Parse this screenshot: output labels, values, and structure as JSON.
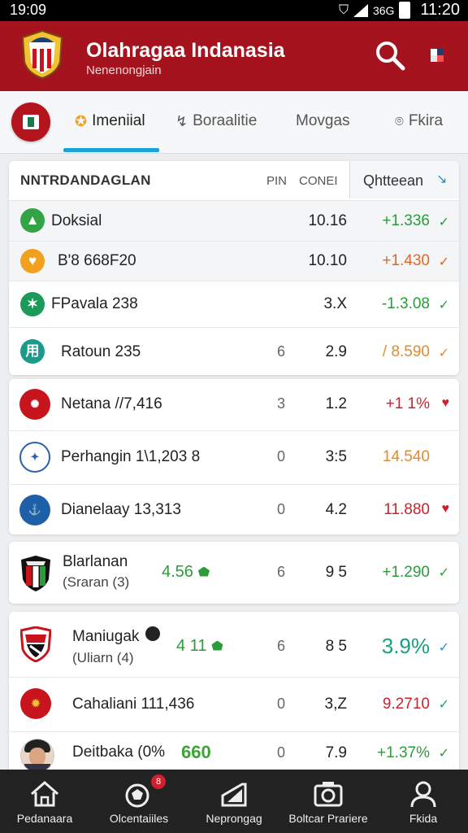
{
  "status": {
    "left_time": "19:09",
    "network": "36G",
    "right_time": "11:20"
  },
  "app": {
    "title": "Olahragaa Indanasia",
    "subtitle": "Nenenongjain"
  },
  "tabs": [
    {
      "label": "Imeniial",
      "icon": "trophy-icon",
      "active": true
    },
    {
      "label": "Boraalitie",
      "icon": "whistle-icon",
      "active": false
    },
    {
      "label": "Movgas",
      "icon": "none",
      "active": false
    },
    {
      "label": "Fkira",
      "icon": "location-icon",
      "active": false
    }
  ],
  "table": {
    "title": "NNTRDANDAGLAN",
    "col_pin": "PIN",
    "col_conv": "CONEI",
    "filter_label": "Qhtteean"
  },
  "group1": [
    {
      "name": "Doksial",
      "col1": "",
      "col2": "10.16",
      "change": "+1.336",
      "change_color": "#2a9d3a",
      "icon_color": "#33a346",
      "icon_glyph": "▲",
      "mark": "✓",
      "mark_color": "#2a9d3a"
    },
    {
      "name": "B'8 668F20",
      "col1": "",
      "col2": "10.10",
      "change": "+1.430",
      "change_color": "#e0662a",
      "icon_color": "#f2a01f",
      "icon_glyph": "♥",
      "mark": "✓",
      "mark_color": "#e0662a"
    },
    {
      "name": "FPavala 238",
      "col1": "",
      "col2": "3.X",
      "change": "-1.3.08",
      "change_color": "#2a9d3a",
      "icon_color": "#1b9a5a",
      "icon_glyph": "✶",
      "mark": "✓",
      "mark_color": "#2a9d3a"
    },
    {
      "name": "Ratoun 235",
      "col1": "6",
      "col2": "2.9",
      "change": "/ 8.590",
      "change_color": "#e38a2f",
      "icon_color": "#1a9a8a",
      "icon_glyph": "用",
      "mark": "✓",
      "mark_color": "#e38a2f"
    }
  ],
  "group2": [
    {
      "name": "Netana //7,416",
      "col1": "3",
      "col2": "1.2",
      "change": "+1 1%",
      "change_color": "#d0202c",
      "icon_color": "#c8141c",
      "mark": "♥",
      "mark_color": "#d0202c"
    },
    {
      "name": "Perhangin 1\\1,203 8",
      "col1": "0",
      "col2": "3:5",
      "change": "14.540",
      "change_color": "#e38a2f",
      "icon_color": "#2a5fb0",
      "mark": "",
      "mark_color": "#d0202c"
    },
    {
      "name": "Dianelaay 13,313",
      "col1": "0",
      "col2": "4.2",
      "change": "11.880",
      "change_color": "#d0202c",
      "icon_color": "#1e5fa8",
      "mark": "♥",
      "mark_color": "#d0202c"
    }
  ],
  "group3": [
    {
      "name": "Blarlanan",
      "sub": "(Sraran (3)",
      "extra": "4.56",
      "col1": "6",
      "col2": "9 5",
      "change": "+1.290",
      "change_color": "#2a9d3a",
      "mark": "✓",
      "mark_color": "#2a9d3a"
    }
  ],
  "group4": [
    {
      "name": "Maniugak",
      "sub": "(Uliarn (4)",
      "extra": "4 11",
      "col1": "6",
      "col2": "8 5",
      "change": "3.9%",
      "change_color": "#1aa07f",
      "mark": "✓",
      "mark_color": "#1a9ad0"
    },
    {
      "name": "Cahaliani 111,436",
      "col1": "0",
      "col2": "3,Z",
      "change": "9.2710",
      "change_color": "#d0202c",
      "mark": "✓",
      "mark_color": "#1aa07f"
    },
    {
      "name": "Deitbaka (0%",
      "badge": "660",
      "col1": "0",
      "col2": "7.9",
      "change": "+1.37%",
      "change_color": "#2a9d3a",
      "mark": "✓",
      "mark_color": "#2a9d3a"
    }
  ],
  "nav": [
    {
      "label": "Pedanaara",
      "icon": "home-icon"
    },
    {
      "label": "Olcentaiiles",
      "icon": "ball-icon",
      "badge": "8"
    },
    {
      "label": "Neprongag",
      "icon": "chart-icon"
    },
    {
      "label": "Boltcar Prariere",
      "icon": "camera-icon"
    },
    {
      "label": "Fkida",
      "icon": "profile-icon"
    }
  ]
}
